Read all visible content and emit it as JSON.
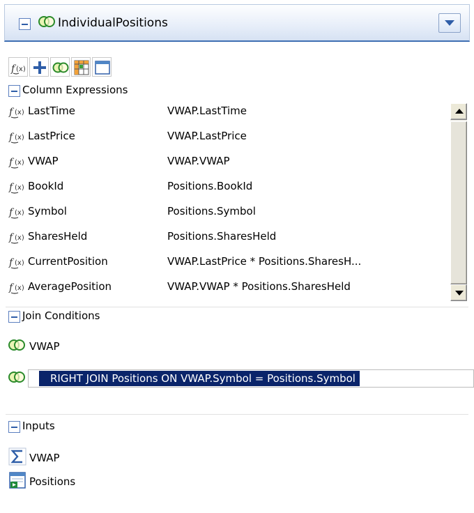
{
  "window": {
    "title": "IndividualPositions",
    "icon": "venn-join-icon",
    "dropdown_icon": "chevron-down-icon"
  },
  "toolbar": {
    "buttons": [
      "add-expression-icon",
      "add-icon",
      "join-icon",
      "grid-icon",
      "table-icon"
    ]
  },
  "column_expressions": {
    "header": "Column Expressions",
    "rows": [
      {
        "name": "LastTime",
        "expression": "VWAP.LastTime"
      },
      {
        "name": "LastPrice",
        "expression": "VWAP.LastPrice"
      },
      {
        "name": "VWAP",
        "expression": "VWAP.VWAP"
      },
      {
        "name": "BookId",
        "expression": "Positions.BookId"
      },
      {
        "name": "Symbol",
        "expression": "Positions.Symbol"
      },
      {
        "name": "SharesHeld",
        "expression": "Positions.SharesHeld"
      },
      {
        "name": "CurrentPosition",
        "expression": "VWAP.LastPrice * Positions.SharesH..."
      },
      {
        "name": "AveragePosition",
        "expression": "VWAP.VWAP * Positions.SharesHeld"
      }
    ]
  },
  "join_conditions": {
    "header": "Join Conditions",
    "first": "VWAP",
    "condition": "RIGHT JOIN Positions ON VWAP.Symbol = Positions.Symbol"
  },
  "inputs": {
    "header": "Inputs",
    "items": [
      {
        "name": "VWAP",
        "icon": "sigma-icon"
      },
      {
        "name": "Positions",
        "icon": "table-input-icon"
      }
    ]
  },
  "colors": {
    "accent": "#3f6fb2",
    "selection": "#0a246a"
  }
}
